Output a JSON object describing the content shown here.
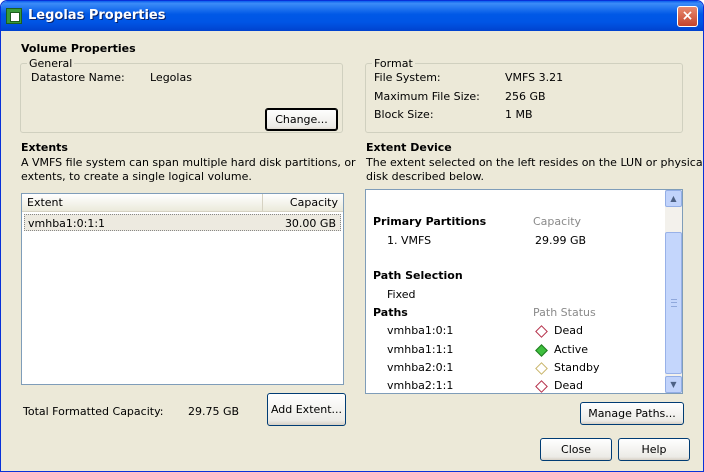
{
  "window": {
    "title": "Legolas Properties",
    "close_label": "×"
  },
  "volume_properties": {
    "heading": "Volume Properties",
    "general": {
      "legend": "General",
      "datastore_name_label": "Datastore Name:",
      "datastore_name_value": "Legolas",
      "change_button": "Change..."
    },
    "format": {
      "legend": "Format",
      "rows": [
        {
          "label": "File System:",
          "value": "VMFS 3.21"
        },
        {
          "label": "Maximum File Size:",
          "value": "256 GB"
        },
        {
          "label": "Block Size:",
          "value": "1 MB"
        }
      ]
    }
  },
  "extents": {
    "heading": "Extents",
    "description_line1": "A VMFS file system can span multiple hard disk partitions, or",
    "description_line2": "extents, to create a single logical volume.",
    "columns": [
      "Extent",
      "Capacity"
    ],
    "rows": [
      {
        "extent": "vmhba1:0:1:1",
        "capacity": "30.00 GB"
      }
    ],
    "total_label": "Total Formatted Capacity:",
    "total_value": "29.75 GB",
    "add_extent_button": "Add Extent..."
  },
  "extent_device": {
    "heading": "Extent Device",
    "description_line1": "The extent selected on the left resides on the LUN or physical",
    "description_line2": "disk described below.",
    "primary_partitions_label": "Primary Partitions",
    "capacity_label": "Capacity",
    "partitions": [
      {
        "name": "1. VMFS",
        "capacity": "29.99 GB"
      }
    ],
    "path_selection_label": "Path Selection",
    "path_selection_value": "Fixed",
    "paths_label": "Paths",
    "path_status_label": "Path Status",
    "paths": [
      {
        "name": "vmhba1:0:1",
        "status": "Dead",
        "icon": "dead-icon"
      },
      {
        "name": "vmhba1:1:1",
        "status": "Active",
        "icon": "active-icon"
      },
      {
        "name": "vmhba2:0:1",
        "status": "Standby",
        "icon": "standby-icon"
      },
      {
        "name": "vmhba2:1:1",
        "status": "Dead",
        "icon": "dead-icon"
      }
    ],
    "manage_paths_button": "Manage Paths..."
  },
  "footer": {
    "close_button": "Close",
    "help_button": "Help"
  },
  "colors": {
    "titlebar": "#0058E6",
    "dialog_bg": "#ECE9D8",
    "dead": "#B5304A",
    "active": "#3FBF3F",
    "standby": "#C9B56A"
  }
}
